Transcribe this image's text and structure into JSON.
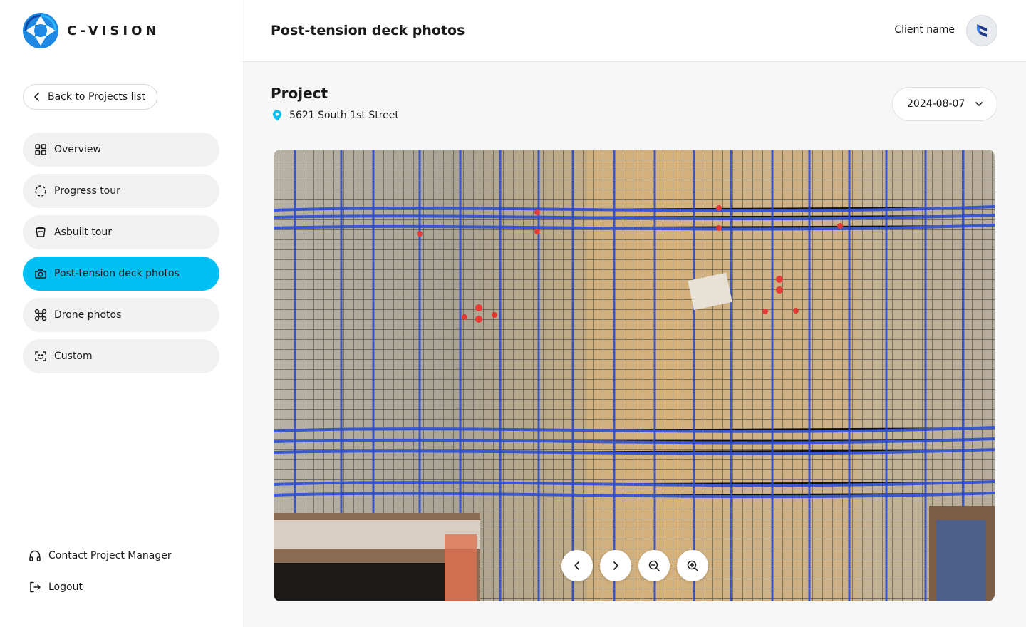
{
  "brand": {
    "name": "C-VISION",
    "accent": "#00bff3"
  },
  "sidebar": {
    "back_label": "Back to Projects list",
    "items": [
      {
        "label": "Overview",
        "icon": "grid-icon",
        "active": false
      },
      {
        "label": "Progress tour",
        "icon": "dashed-circle-icon",
        "active": false
      },
      {
        "label": "Asbuilt tour",
        "icon": "bucket-icon",
        "active": false
      },
      {
        "label": "Post-tension deck photos",
        "icon": "camera-icon",
        "active": true
      },
      {
        "label": "Drone photos",
        "icon": "drone-icon",
        "active": false
      },
      {
        "label": "Custom",
        "icon": "scan-icon",
        "active": false
      }
    ],
    "bottom": {
      "contact_label": "Contact Project Manager",
      "logout_label": "Logout"
    }
  },
  "header": {
    "title": "Post-tension deck photos",
    "client_name": "Client name"
  },
  "main": {
    "project_title": "Project",
    "location": "5621 South 1st Street",
    "date_selected": "2024-08-07",
    "controls": [
      "previous-icon",
      "next-icon",
      "zoom-out-icon",
      "zoom-in-icon"
    ]
  }
}
